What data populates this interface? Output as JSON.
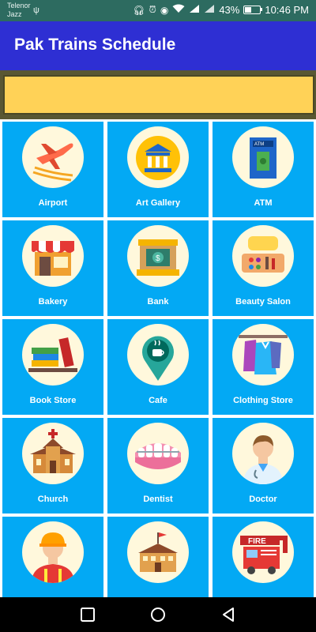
{
  "status_bar": {
    "carrier_line1": "Telenor",
    "carrier_line2": "Jazz",
    "battery": "43%",
    "time": "10:46 PM",
    "icons": [
      "usb-icon",
      "headset-icon",
      "alarm-icon",
      "eye-icon",
      "wifi-icon",
      "signal-4g-icon",
      "signal-3g-icon",
      "battery-icon"
    ]
  },
  "app_bar": {
    "title": "Pak Trains Schedule"
  },
  "categories": [
    {
      "label": "Airport",
      "icon": "airplane-icon"
    },
    {
      "label": "Art Gallery",
      "icon": "museum-icon"
    },
    {
      "label": "ATM",
      "icon": "atm-icon"
    },
    {
      "label": "Bakery",
      "icon": "bakery-shop-icon"
    },
    {
      "label": "Bank",
      "icon": "bank-icon"
    },
    {
      "label": "Beauty Salon",
      "icon": "salon-icon"
    },
    {
      "label": "Book Store",
      "icon": "books-icon"
    },
    {
      "label": "Cafe",
      "icon": "coffee-pin-icon"
    },
    {
      "label": "Clothing Store",
      "icon": "clothes-rack-icon"
    },
    {
      "label": "Church",
      "icon": "church-icon"
    },
    {
      "label": "Dentist",
      "icon": "teeth-icon"
    },
    {
      "label": "Doctor",
      "icon": "doctor-icon"
    },
    {
      "label": "",
      "icon": "worker-icon"
    },
    {
      "label": "",
      "icon": "building-icon"
    },
    {
      "label": "",
      "icon": "fire-station-icon"
    }
  ],
  "fire_sign": "FIRE",
  "nav": [
    "recent-apps-icon",
    "home-icon",
    "back-icon"
  ],
  "colors": {
    "status_bar": "#2d6b60",
    "app_bar": "#2e2fd3",
    "banner": "#ffd257",
    "tile": "#03a9f4",
    "circle": "#fff8dc"
  }
}
